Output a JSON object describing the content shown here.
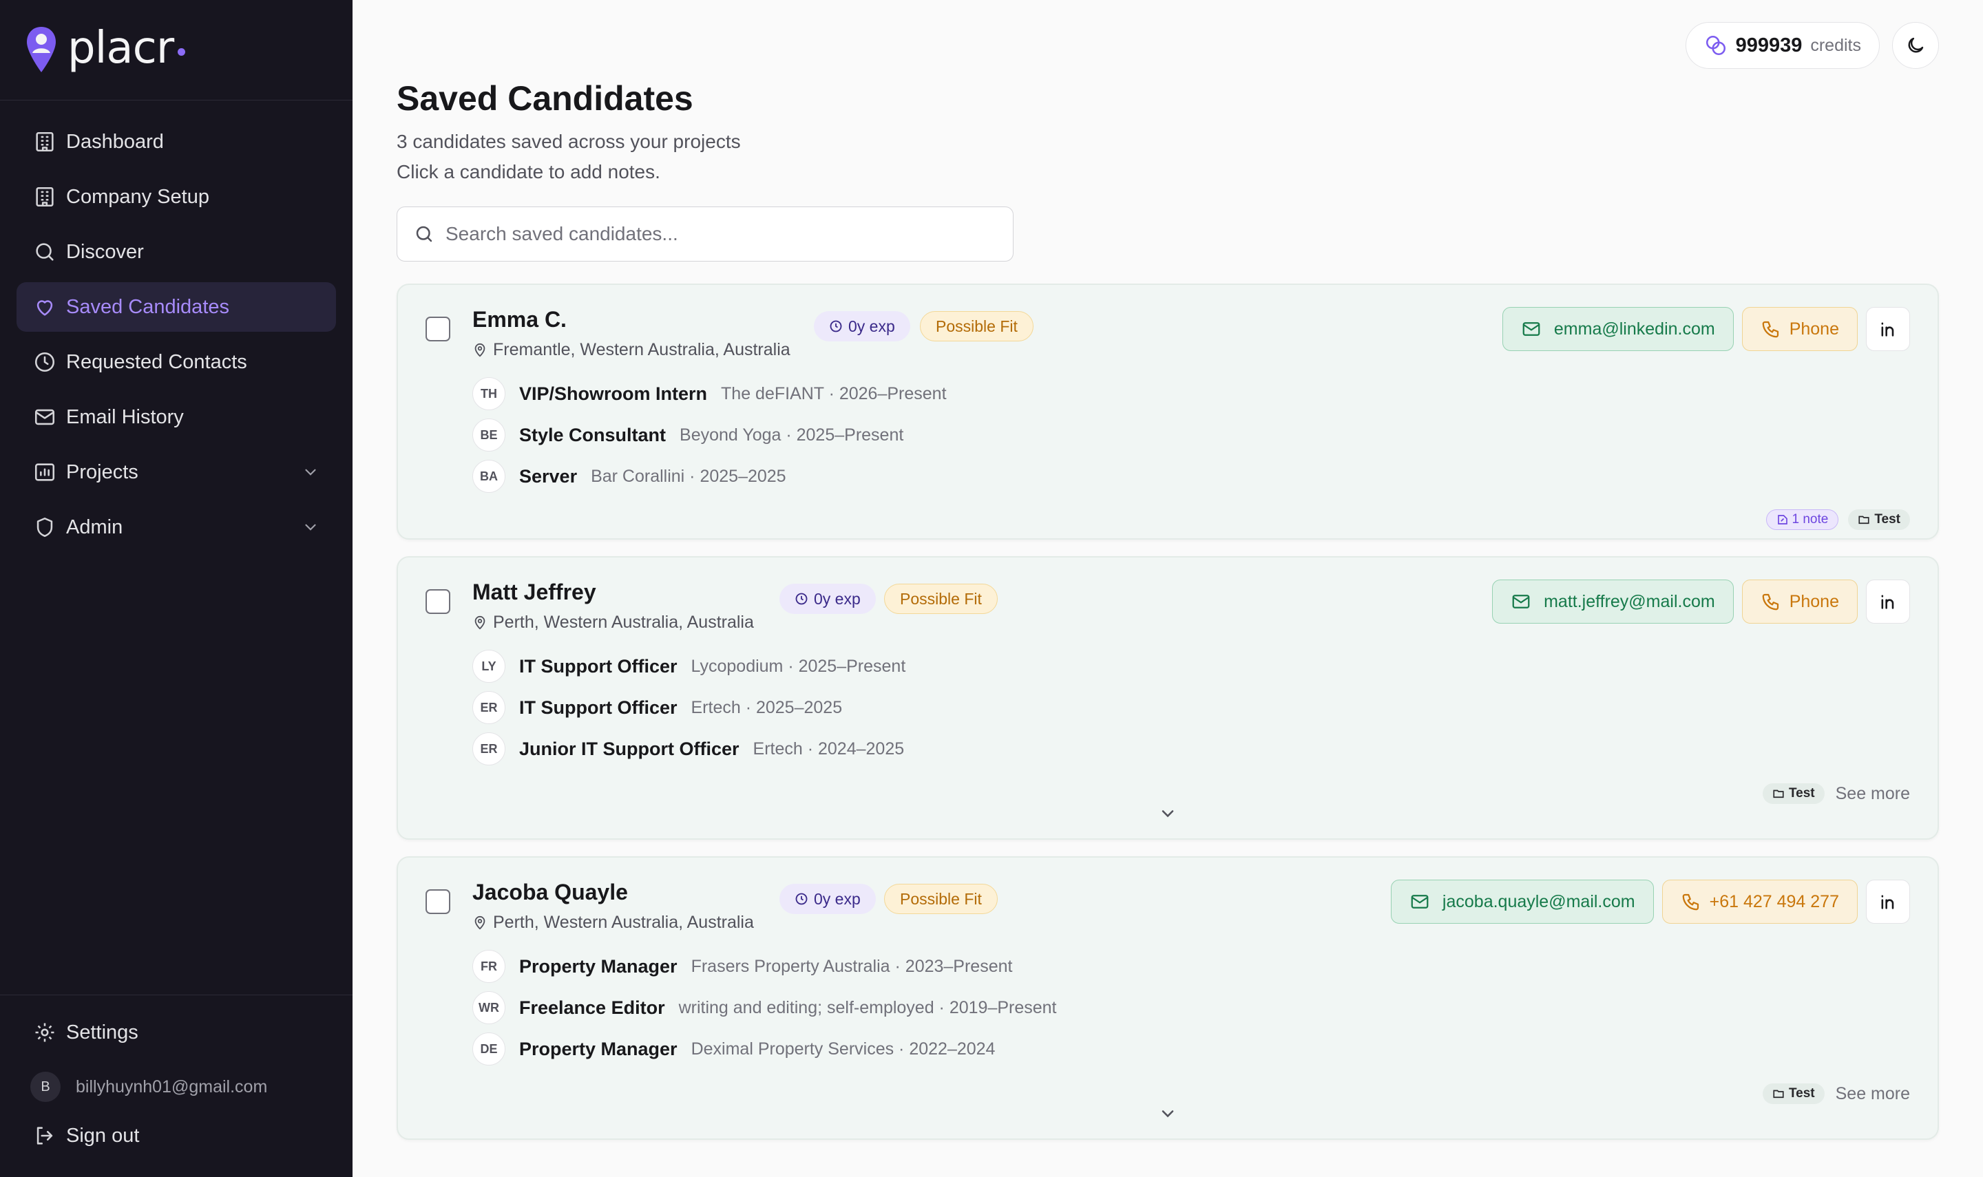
{
  "app": {
    "brand": "placr"
  },
  "sidebar": {
    "items": [
      {
        "label": "Dashboard",
        "icon": "building-icon"
      },
      {
        "label": "Company Setup",
        "icon": "building-icon"
      },
      {
        "label": "Discover",
        "icon": "search-icon"
      },
      {
        "label": "Saved Candidates",
        "icon": "heart-icon",
        "active": true
      },
      {
        "label": "Requested Contacts",
        "icon": "clock-icon"
      },
      {
        "label": "Email History",
        "icon": "mail-icon"
      },
      {
        "label": "Projects",
        "icon": "chart-icon",
        "expandable": true
      },
      {
        "label": "Admin",
        "icon": "shield-icon",
        "expandable": true
      }
    ],
    "settings_label": "Settings",
    "user_initial": "B",
    "user_email": "billyhuynh01@gmail.com",
    "signout_label": "Sign out"
  },
  "topbar": {
    "credits_value": "999939",
    "credits_label": "credits"
  },
  "page": {
    "title": "Saved Candidates",
    "subtitle_line1": "3 candidates saved across your projects",
    "subtitle_line2": "Click a candidate to add notes."
  },
  "search": {
    "placeholder": "Search saved candidates..."
  },
  "candidates": [
    {
      "name": "Emma C.",
      "location": "Fremantle, Western Australia, Australia",
      "experience_badge": "0y exp",
      "fit_badge": "Possible Fit",
      "email": "emma@linkedin.com",
      "phone": "Phone",
      "experience": [
        {
          "initials": "TH",
          "title": "VIP/Showroom Intern",
          "meta": "The deFIANT · 2026–Present"
        },
        {
          "initials": "BE",
          "title": "Style Consultant",
          "meta": "Beyond Yoga · 2025–Present"
        },
        {
          "initials": "BA",
          "title": "Server",
          "meta": "Bar Corallini · 2025–2025"
        }
      ],
      "note_tag": "1 note",
      "project_tag": "Test"
    },
    {
      "name": "Matt Jeffrey",
      "location": "Perth, Western Australia, Australia",
      "experience_badge": "0y exp",
      "fit_badge": "Possible Fit",
      "email": "matt.jeffrey@mail.com",
      "phone": "Phone",
      "experience": [
        {
          "initials": "LY",
          "title": "IT Support Officer",
          "meta": "Lycopodium · 2025–Present"
        },
        {
          "initials": "ER",
          "title": "IT Support Officer",
          "meta": "Ertech · 2025–2025"
        },
        {
          "initials": "ER",
          "title": "Junior IT Support Officer",
          "meta": "Ertech · 2024–2025"
        }
      ],
      "project_tag": "Test",
      "see_more": "See more"
    },
    {
      "name": "Jacoba Quayle",
      "location": "Perth, Western Australia, Australia",
      "experience_badge": "0y exp",
      "fit_badge": "Possible Fit",
      "email": "jacoba.quayle@mail.com",
      "phone": "+61 427 494 277",
      "experience": [
        {
          "initials": "FR",
          "title": "Property Manager",
          "meta": "Frasers Property Australia · 2023–Present"
        },
        {
          "initials": "WR",
          "title": "Freelance Editor",
          "meta": "writing and editing; self-employed · 2019–Present"
        },
        {
          "initials": "DE",
          "title": "Property Manager",
          "meta": "Deximal Property Services · 2022–2024"
        }
      ],
      "project_tag": "Test",
      "see_more": "See more"
    }
  ],
  "colors": {
    "sidebar_bg": "#17151f",
    "accent": "#a78bfa",
    "email_green": "#167a4a",
    "phone_amber": "#c9770c",
    "card_bg": "#f1f6f4"
  }
}
